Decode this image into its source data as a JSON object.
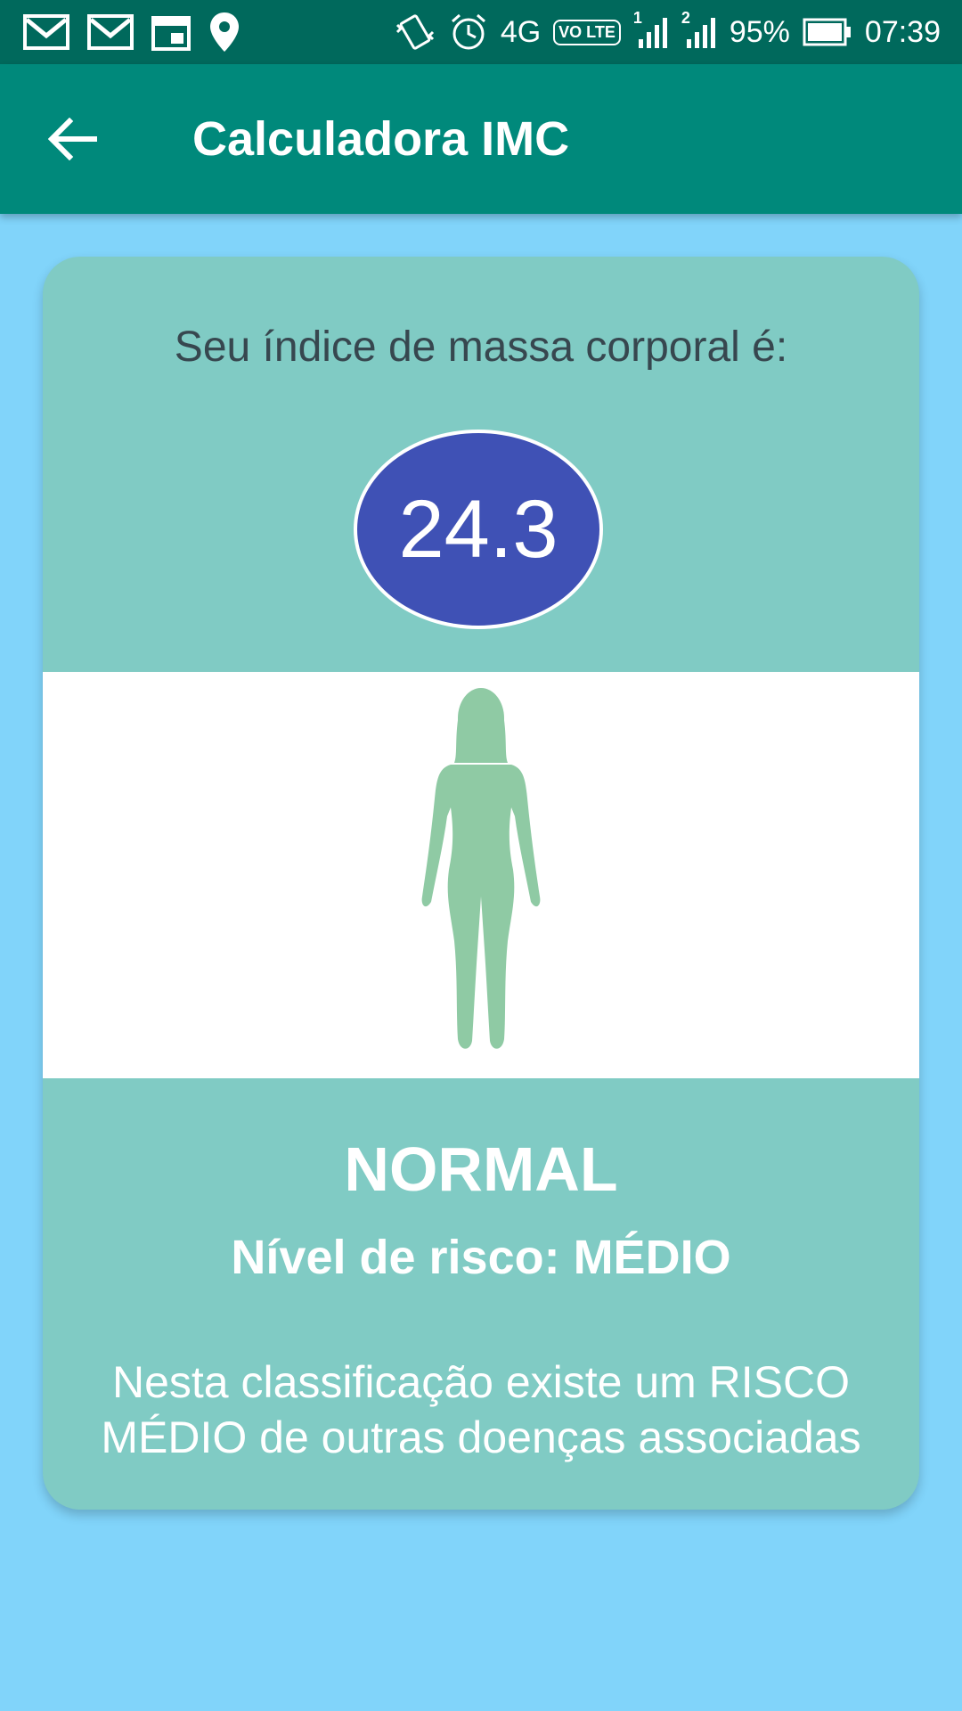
{
  "status_bar": {
    "icons_left": [
      "gmail-icon",
      "gmail-icon",
      "calendar-icon",
      "location-pin-icon"
    ],
    "icons_right": [
      "vibrate-icon",
      "alarm-icon"
    ],
    "network": "4G",
    "volte": "VO LTE",
    "sim1": "1",
    "sim2": "2",
    "battery": "95%",
    "time": "07:39"
  },
  "app_bar": {
    "back_icon": "arrow-left-icon",
    "title": "Calculadora IMC"
  },
  "result": {
    "heading": "Seu índice de massa corporal é:",
    "bmi_value": "24.3",
    "figure_icon": "female-silhouette-icon",
    "classification": "NORMAL",
    "risk_level": "Nível de risco: MÉDIO",
    "description": "Nesta classificação existe um RISCO MÉDIO de outras doenças associadas"
  },
  "colors": {
    "status_bar": "#00695c",
    "app_bar": "#00897b",
    "background": "#81d4fa",
    "card": "#80cbc4",
    "bmi_oval": "#3f51b5",
    "figure": "#8fcaa4"
  }
}
